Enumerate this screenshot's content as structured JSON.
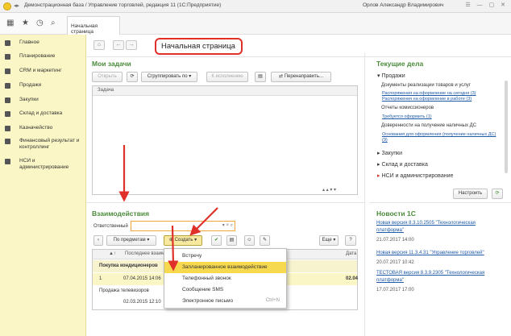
{
  "titlebar": {
    "title": "Демонстрационная база / Управление торговлей, редакция 11  (1С:Предприятие)",
    "user": "Орлов Александр Владимирович"
  },
  "tabs": {
    "home": "Начальная страница"
  },
  "sidebar": {
    "items": [
      {
        "label": "Главное",
        "icon": "menu-icon"
      },
      {
        "label": "Планирование",
        "icon": "planning-icon"
      },
      {
        "label": "CRM и маркетинг",
        "icon": "crm-icon"
      },
      {
        "label": "Продажи",
        "icon": "sales-icon"
      },
      {
        "label": "Закупки",
        "icon": "purchases-icon"
      },
      {
        "label": "Склад и доставка",
        "icon": "warehouse-icon"
      },
      {
        "label": "Казначейство",
        "icon": "treasury-icon"
      },
      {
        "label": "Финансовый результат и контроллинг",
        "icon": "finance-icon"
      },
      {
        "label": "НСИ и администрирование",
        "icon": "settings-icon"
      }
    ]
  },
  "page": {
    "title": "Начальная страница"
  },
  "tasks": {
    "title": "Мои задачи",
    "open": "Открыть",
    "group_by": "Сгруппировать по",
    "to_execute": "К исполнению",
    "reassign": "Перенаправить...",
    "col_task": "Задача"
  },
  "interactions": {
    "title": "Взаимодействия",
    "responsible_label": "Ответственный",
    "by_subjects": "По предметам",
    "create": "Создать",
    "more": "Еще",
    "help": "?",
    "col_last": "Последнее взаим",
    "col_date": "Дата",
    "rows": [
      {
        "text": "Покупка кондиционеров",
        "bold": true,
        "date": "",
        "num": ""
      },
      {
        "text": "07.04.2015 14:06",
        "bold": false,
        "date": "",
        "num": "1",
        "extra": "02.04"
      },
      {
        "text": "Продажа телевизоров",
        "bold": false,
        "date": "",
        "num": ""
      },
      {
        "text": "02.03.2015 12:10",
        "bold": false,
        "date": "",
        "num": ""
      }
    ],
    "create_menu": [
      {
        "label": "Встречу",
        "shortcut": ""
      },
      {
        "label": "Запланированное взаимодействие",
        "shortcut": "",
        "selected": true
      },
      {
        "label": "Телефонный звонок",
        "shortcut": ""
      },
      {
        "label": "Сообщение SMS",
        "shortcut": ""
      },
      {
        "label": "Электронное письмо",
        "shortcut": "Ctrl+N"
      }
    ]
  },
  "current": {
    "title": "Текущие дела",
    "sales_group": "Продажи",
    "docs_title": "Документы реализации товаров и услуг",
    "docs_link1": "Распоряжения на оформление на сегодня (3)",
    "docs_link2": "Распоряжения на оформление в работе (3)",
    "commission_title": "Отчеты комиссионеров",
    "commission_link": "Требуется оформить (1)",
    "poa_title": "Доверенности на получение наличных ДС",
    "poa_link1": "Основания для оформления (получение наличных ДС)",
    "poa_link2": "(9)",
    "groups": [
      "Закупки",
      "Склад и доставка",
      "НСИ и администрирование"
    ],
    "configure": "Настроить"
  },
  "news": {
    "title": "Новости 1С",
    "items": [
      {
        "line1": "Новая версия 8.3.10.2505 \"Технологическая",
        "line2": "платформа\"",
        "date": "21.07.2017 14:00"
      },
      {
        "line1": "Новая версия 11.3.4.31 \"Управление торговлей\"",
        "line2": "",
        "date": "20.07.2017 10:42"
      },
      {
        "line1": "ТЕСТОВАЯ версия 8.3.9.2305 \"Технологическая",
        "line2": "платформа\"",
        "date": "17.07.2017 17:00"
      }
    ]
  },
  "colors": {
    "accent_green": "#4b8b3b",
    "sidebar_bg": "#fbf6c5",
    "highlight": "#f7d94f",
    "annotation_red": "#e0302a",
    "link": "#1e5aa8"
  }
}
